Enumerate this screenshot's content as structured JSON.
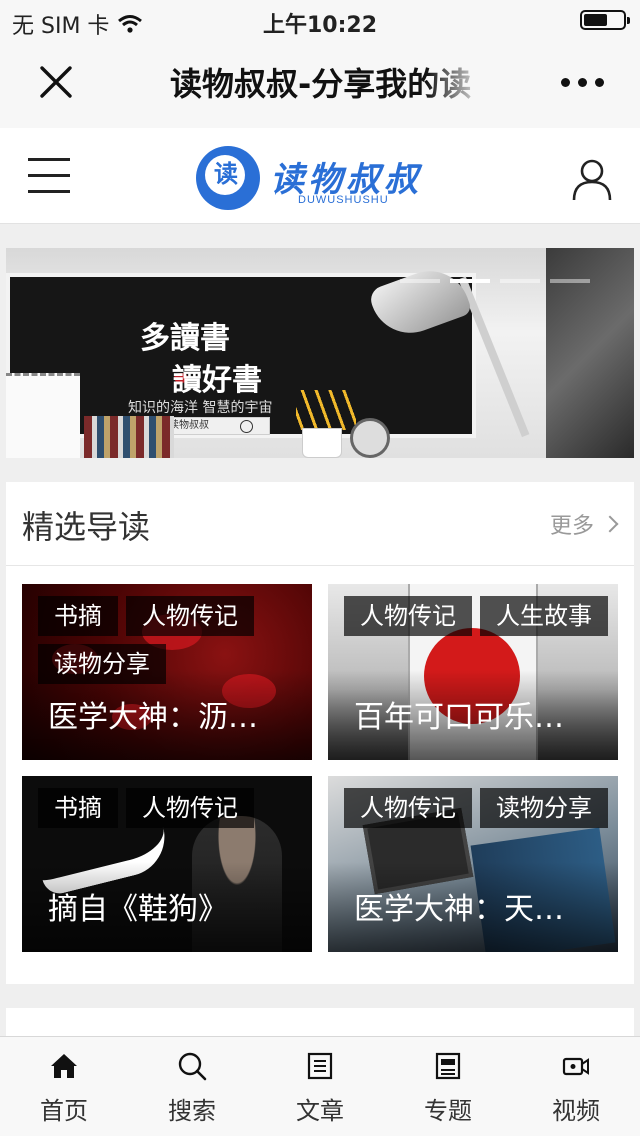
{
  "status_bar": {
    "carrier": "无 SIM 卡",
    "time": "上午10:22",
    "battery_level": 0.6
  },
  "nav_bar": {
    "title": "读物叔叔-分享我的读",
    "close_icon": "close-icon",
    "more_icon": "more-icon"
  },
  "header": {
    "menu_icon": "hamburger-icon",
    "logo_text": "读物叔叔",
    "logo_badge": "读",
    "logo_sub": "DUWUSHUSHU",
    "user_icon": "user-icon"
  },
  "banner": {
    "line1": "多讀書",
    "line2": "讀好書",
    "subtitle": "知识的海洋 智慧的宇宙",
    "button": "读物叔叔",
    "slide_count": 4,
    "active_slide": 2
  },
  "featured": {
    "title": "精选导读",
    "more": "更多",
    "cards": [
      {
        "tags": [
          "书摘",
          "人物传记",
          "读物分享"
        ],
        "title": "医学大神：沥…"
      },
      {
        "tags": [
          "人物传记",
          "人生故事"
        ],
        "title": "百年可口可乐…"
      },
      {
        "tags": [
          "书摘",
          "人物传记"
        ],
        "title": "摘自《鞋狗》"
      },
      {
        "tags": [
          "人物传记",
          "读物分享"
        ],
        "title": "医学大神：天…"
      }
    ]
  },
  "tab_bar": {
    "tabs": [
      {
        "label": "首页",
        "icon": "home-icon"
      },
      {
        "label": "搜索",
        "icon": "search-icon"
      },
      {
        "label": "文章",
        "icon": "article-icon"
      },
      {
        "label": "专题",
        "icon": "topic-icon"
      },
      {
        "label": "视频",
        "icon": "video-icon"
      }
    ]
  },
  "colors": {
    "brand": "#2a6fd6",
    "tag_bg": "#000000",
    "more_text": "#999999"
  }
}
